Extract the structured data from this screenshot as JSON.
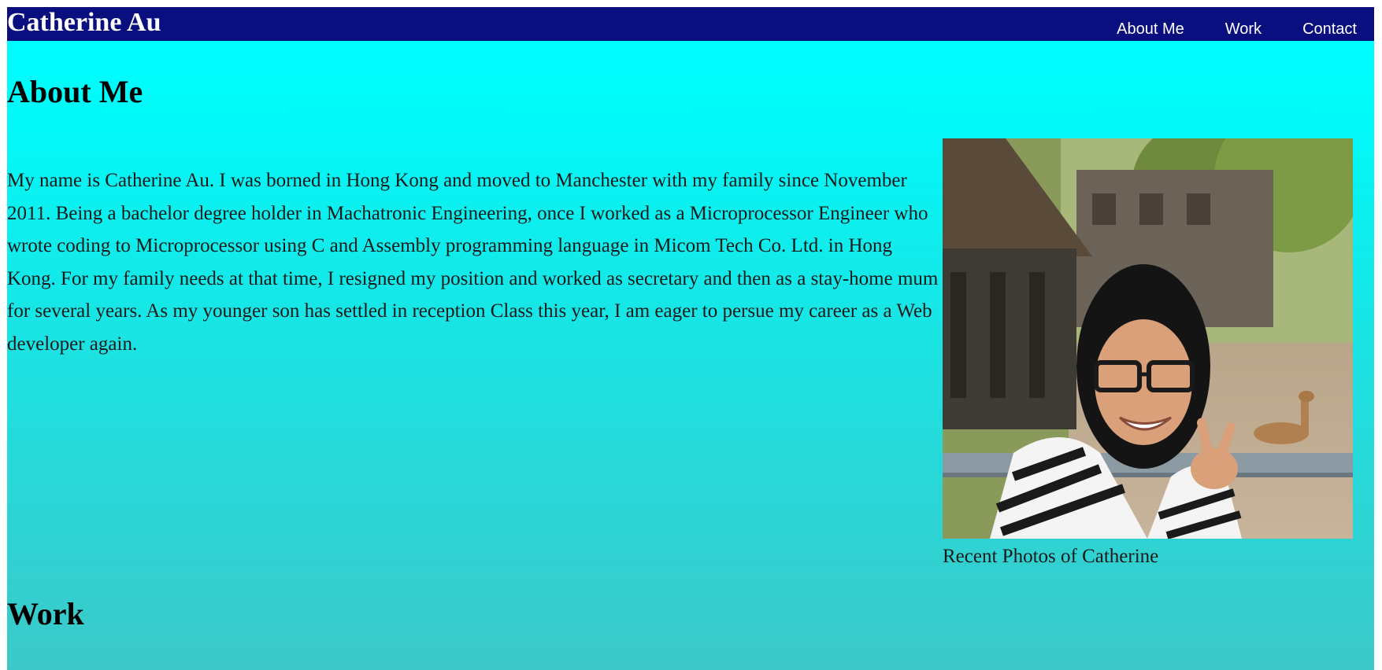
{
  "header": {
    "brand": "Catherine Au",
    "nav": [
      "About Me",
      "Work",
      "Contact"
    ]
  },
  "about": {
    "title": "About Me",
    "text": "My name is Catherine Au. I was borned in Hong Kong and moved to Manchester with my family since November 2011. Being a bachelor degree holder in Machatronic Engineering, once I worked as a Microprocessor Engineer who wrote coding to Microprocessor using C and Assembly programming language in Micom Tech Co. Ltd. in Hong Kong. For my family needs at that time, I resigned my position and worked as secretary and then as a stay-home mum for several years. As my younger son has settled in reception Class this year, I am eager to persue my career as a Web developer again.",
    "photo_caption": "Recent Photos of Catherine"
  },
  "work": {
    "title": "Work"
  },
  "colors": {
    "navbar": "#0a0f80",
    "gradient_top": "#00ffff",
    "gradient_bottom": "#3cc8c8"
  }
}
